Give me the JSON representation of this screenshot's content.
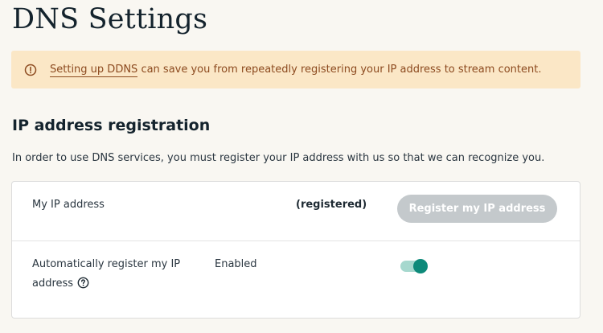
{
  "page": {
    "title": "DNS Settings"
  },
  "alert": {
    "icon": "warning-circle-icon",
    "link_text": "Setting up DDNS",
    "message": " can save you from repeatedly registering your IP address to stream content.",
    "colors": {
      "background": "#fbe7c6",
      "text": "#8c4a1f"
    }
  },
  "section": {
    "heading": "IP address registration",
    "description": "In order to use DNS services, you must register your IP address with us so that we can recognize you."
  },
  "ip_row": {
    "label": "My IP address",
    "status": "(registered)",
    "button_label": "Register my IP address"
  },
  "auto_row": {
    "label": "Automatically register my IP address",
    "help_icon": "question-circle-icon",
    "status": "Enabled",
    "toggle_on": true,
    "toggle_color": "#0e8a7a"
  }
}
